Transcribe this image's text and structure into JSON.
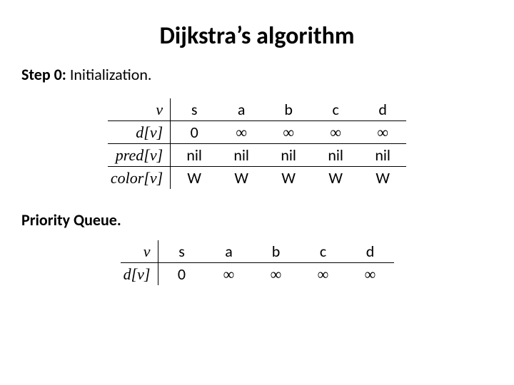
{
  "title": "Dijkstra’s algorithm",
  "step": {
    "label": "Step 0:",
    "text": " Initialization."
  },
  "pq_label": "Priority Queue.",
  "infinity": "∞",
  "table1": {
    "headers": [
      "v",
      "s",
      "a",
      "b",
      "c",
      "d"
    ],
    "rows": [
      {
        "name": "d[v]",
        "cells": [
          "0",
          "∞",
          "∞",
          "∞",
          "∞"
        ]
      },
      {
        "name": "pred[v]",
        "cells": [
          "nil",
          "nil",
          "nil",
          "nil",
          "nil"
        ]
      },
      {
        "name": "color[v]",
        "cells": [
          "W",
          "W",
          "W",
          "W",
          "W"
        ]
      }
    ]
  },
  "table2": {
    "headers": [
      "v",
      "s",
      "a",
      "b",
      "c",
      "d"
    ],
    "rows": [
      {
        "name": "d[v]",
        "cells": [
          "0",
          "∞",
          "∞",
          "∞",
          "∞"
        ]
      }
    ]
  }
}
